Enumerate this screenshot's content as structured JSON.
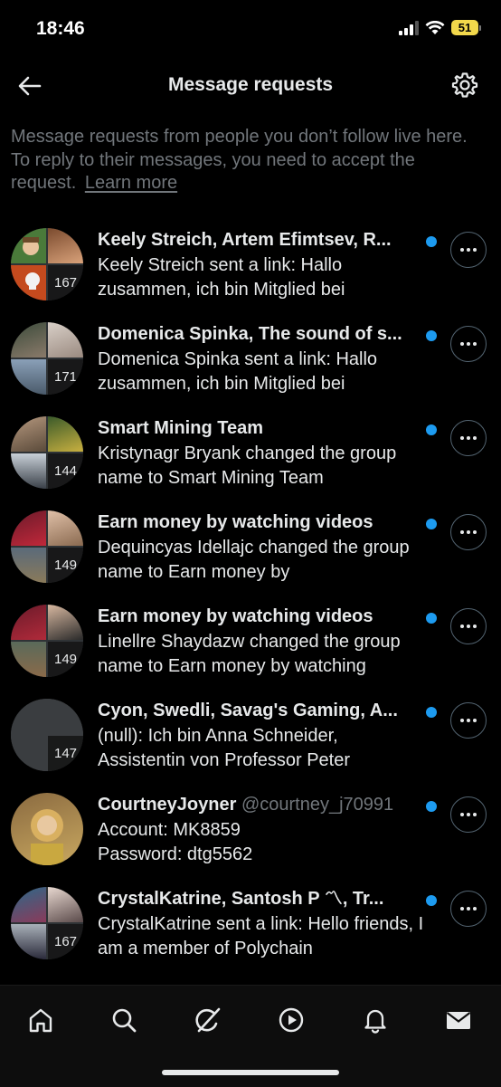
{
  "status_bar": {
    "time": "18:46",
    "battery": "51"
  },
  "header": {
    "title": "Message requests"
  },
  "info": {
    "text": "Message requests from people you don’t follow live here. To reply to their messages, you need to accept the request.",
    "learn_more": "Learn more"
  },
  "requests": [
    {
      "title": "Keely Streich, Artem Efimtsev, R...",
      "handle": "",
      "preview": "Keely Streich sent a link: Hallo zusammen, ich bin Mitglied bei",
      "count": "167",
      "unread": true
    },
    {
      "title": "Domenica Spinka, The sound of s...",
      "handle": "",
      "preview": "Domenica Spinka sent a link: Hallo zusammen, ich bin Mitglied bei",
      "count": "171",
      "unread": true
    },
    {
      "title": "Smart Mining Team",
      "handle": "",
      "preview": "Kristynagr Bryank changed the group name to Smart Mining Team",
      "count": "144",
      "unread": true
    },
    {
      "title": "Earn money by watching videos",
      "handle": "",
      "preview": "Dequincyas Idellajc changed the group name to Earn money by",
      "count": "149",
      "unread": true
    },
    {
      "title": "Earn money by watching videos",
      "handle": "",
      "preview": "Linellre Shaydazw changed the group name to Earn money by watching",
      "count": "149",
      "unread": true
    },
    {
      "title": "Cyon, Swedli, Savag's Gaming, A...",
      "handle": "",
      "preview": "(null): Ich bin Anna Schneider, Assistentin von Professor Peter",
      "count": "147",
      "unread": true
    },
    {
      "title": "CourtneyJoyner",
      "handle": "@courtney_j70991",
      "preview": "Account: MK8859\nPassword: dtg5562",
      "count": "",
      "unread": true
    },
    {
      "title": "CrystalKatrine, Santosh P 〽, Tr...",
      "handle": "",
      "preview": "CrystalKatrine sent a link: Hello friends, I am a member of Polychain",
      "count": "167",
      "unread": true
    }
  ],
  "nav": {
    "items": [
      {
        "icon": "home-icon"
      },
      {
        "icon": "search-icon"
      },
      {
        "icon": "grok-icon"
      },
      {
        "icon": "video-play-icon"
      },
      {
        "icon": "bell-icon"
      },
      {
        "icon": "mail-icon"
      }
    ]
  },
  "colors": {
    "accent": "#1d9bf0",
    "background": "#000000",
    "muted": "#71767b"
  }
}
